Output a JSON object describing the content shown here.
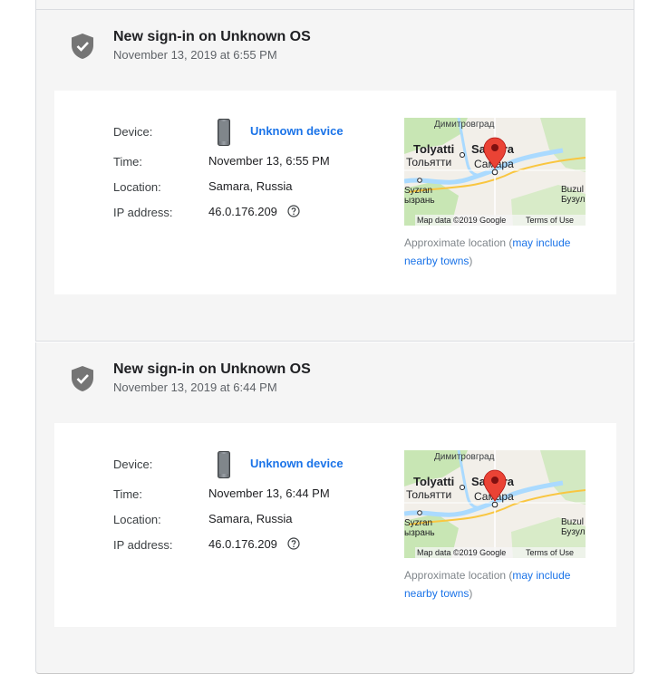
{
  "events": [
    {
      "title": "New sign-in on Unknown OS",
      "datetime": "November 13, 2019 at 6:55 PM",
      "labels": {
        "device": "Device:",
        "time": "Time:",
        "location": "Location:",
        "ip": "IP address:"
      },
      "device_name": "Unknown device",
      "time": "November 13, 6:55 PM",
      "location": "Samara, Russia",
      "ip": "46.0.176.209",
      "map": {
        "dimitrovgrad": "Димитровград",
        "tolyatti": "Tolyatti",
        "tolyatti_ru": "Тольятти",
        "samara": "Samara",
        "samara_ru": "Самара",
        "syzran": "Syzran",
        "syzran_ru": "ызрань",
        "buzul": "Buzul",
        "buzul_ru": "Бузул",
        "attribution": "Map data ©2019 Google",
        "terms": "Terms of Use"
      },
      "approx_prefix": "Approximate location (",
      "approx_link": "may include nearby towns",
      "approx_suffix": ")"
    },
    {
      "title": "New sign-in on Unknown OS",
      "datetime": "November 13, 2019 at 6:44 PM",
      "labels": {
        "device": "Device:",
        "time": "Time:",
        "location": "Location:",
        "ip": "IP address:"
      },
      "device_name": "Unknown device",
      "time": "November 13, 6:44 PM",
      "location": "Samara, Russia",
      "ip": "46.0.176.209",
      "map": {
        "dimitrovgrad": "Димитровград",
        "tolyatti": "Tolyatti",
        "tolyatti_ru": "Тольятти",
        "samara": "Samara",
        "samara_ru": "Самара",
        "syzran": "Syzran",
        "syzran_ru": "ызрань",
        "buzul": "Buzul",
        "buzul_ru": "Бузул",
        "attribution": "Map data ©2019 Google",
        "terms": "Terms of Use"
      },
      "approx_prefix": "Approximate location (",
      "approx_link": "may include nearby towns",
      "approx_suffix": ")"
    }
  ],
  "colors": {
    "link": "#1a73e8",
    "pin": "#ea4335",
    "shield": "#757575"
  }
}
